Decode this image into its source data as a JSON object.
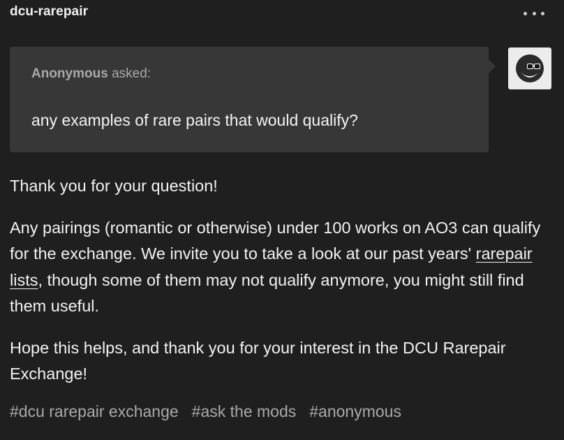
{
  "post": {
    "blog_name": "dcu-rarepair",
    "more_icon": "ellipsis-horizontal-icon",
    "ask": {
      "asker": "Anonymous",
      "asked_label": "asked:",
      "question": "any examples of rare pairs that would qualify?",
      "avatar_icon": "sunglasses-face-icon"
    },
    "answer": {
      "p1": "Thank you for your question!",
      "p2_before": "Any pairings (romantic or otherwise) under 100 works on AO3 can qualify for the exchange. We invite you to take a look at our past years' ",
      "p2_link": "rarepair lists",
      "p2_after": ", though some of them may not qualify anymore, you might still find them useful.",
      "p3": "Hope this helps, and thank you for your interest in the DCU Rarepair Exchange!"
    },
    "tags": [
      "#dcu rarepair exchange",
      "#ask the mods",
      "#anonymous"
    ]
  }
}
